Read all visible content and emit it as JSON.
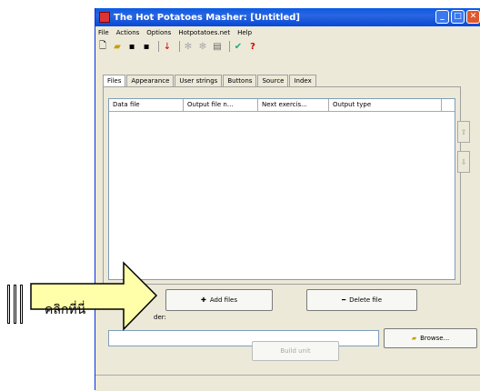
{
  "window": {
    "title": "The Hot Potatoes Masher: [Untitled]",
    "buttons": [
      "minimize",
      "maximize",
      "close"
    ]
  },
  "menu": [
    "File",
    "Actions",
    "Options",
    "Hotpotatoes.net",
    "Help"
  ],
  "toolbar": [
    "new-icon",
    "open-icon",
    "save-icon",
    "save-as-icon",
    "down-arrow-icon",
    "gear-icon",
    "gear-icon",
    "copy-icon",
    "web-icon",
    "help-icon"
  ],
  "tabs": [
    "Files",
    "Appearance",
    "User strings",
    "Buttons",
    "Source",
    "Index"
  ],
  "active_tab": "Files",
  "columns": [
    "Data file",
    "Output file n...",
    "Next exercis...",
    "Output type"
  ],
  "buttons": {
    "add": "Add files",
    "delete": "Delete file",
    "browse": "Browse...",
    "build": "Build unit"
  },
  "folder_label": "der:",
  "folder_value": "",
  "callout": "คลิกที่นี่"
}
